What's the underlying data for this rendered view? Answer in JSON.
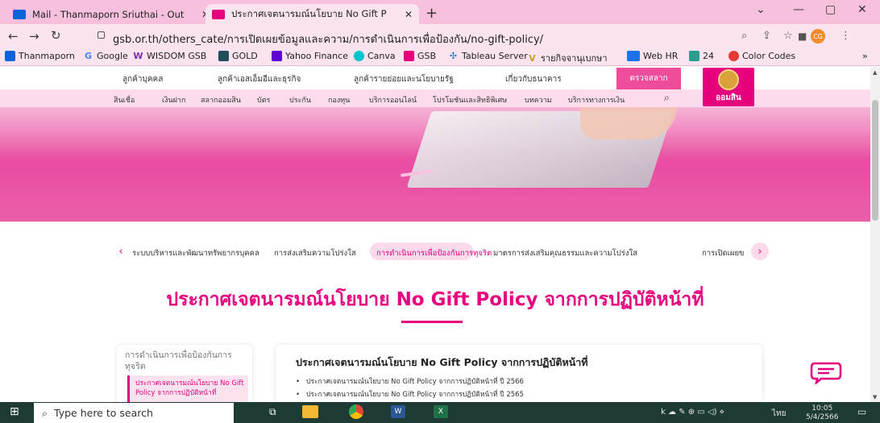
{
  "browser": {
    "tabs": [
      {
        "title": "Mail - Thanmaporn Sriuthai - Out",
        "active": false
      },
      {
        "title": "ประกาศเจตนารมณ์นโยบาย No Gift P",
        "active": true
      }
    ],
    "url": "gsb.or.th/others_cate/การเปิดเผยข้อมูลและความ/การดำเนินการเพื่อป้องกัน/no-gift-policy/",
    "profile_initials": "CG",
    "bookmarks": [
      {
        "label": "Thanmaporn",
        "icon": "outlook-icon",
        "color": "#0a64d8"
      },
      {
        "label": "Google",
        "icon": "google-icon",
        "color": "#4285f4"
      },
      {
        "label": "WISDOM GSB",
        "icon": "wisdom-icon",
        "color": "#7b2fb0"
      },
      {
        "label": "GOLD",
        "icon": "gold-icon",
        "color": "#1f4e5a"
      },
      {
        "label": "Yahoo Finance",
        "icon": "yahoo-icon",
        "color": "#6001d2"
      },
      {
        "label": "Canva",
        "icon": "canva-icon",
        "color": "#00c4cc"
      },
      {
        "label": "GSB",
        "icon": "gsb-icon",
        "color": "#e6007e"
      },
      {
        "label": "Tableau Server",
        "icon": "tableau-icon",
        "color": "#1f77b4"
      },
      {
        "label": "รายกิจจานุเบกษา",
        "icon": "gazette-icon",
        "color": "#c9a227"
      },
      {
        "label": "Web HR",
        "icon": "sap-icon",
        "color": "#1a73e8"
      },
      {
        "label": "24",
        "icon": "app24-icon",
        "color": "#2a9d8f"
      },
      {
        "label": "Color Codes",
        "icon": "colorcodes-icon",
        "color": "#e53935"
      }
    ]
  },
  "site": {
    "top_nav": [
      "ลูกค้าบุคคล",
      "ลูกค้าเอสเอ็มอีและธุรกิจ",
      "ลูกค้ารายย่อยและนโยบายรัฐ",
      "เกี่ยวกับธนาคาร"
    ],
    "lottery_label": "ตรวจสลาก",
    "sub_nav": [
      "สินเชื่อ",
      "เงินฝาก",
      "สลากออมสิน",
      "บัตร",
      "ประกัน",
      "กองทุน",
      "บริการออนไลน์",
      "โปรโมชันและสิทธิพิเศษ",
      "บทความ",
      "บริการทางการเงิน"
    ],
    "logo_text": "ออมสิน",
    "categories": [
      "ระบบบริหารและพัฒนาทรัพยากรบุคคล",
      "การส่งเสริมความโปร่งใส",
      "การดำเนินการเพื่อป้องกันการทุจริต",
      "มาตรการส่งเสริมคุณธรรมและความโปร่งใส",
      "การเปิดเผยข"
    ],
    "active_category_index": 2,
    "page_title": "ประกาศเจตนารมณ์นโยบาย No Gift Policy จากการปฏิบัติหน้าที่",
    "sidebar_heading": "การดำเนินการเพื่อป้องกันการทุจริต",
    "sidebar_item": "ประกาศเจตนารมณ์นโยบาย No Gift Policy จากการปฏิบัติหน้าที่",
    "content_heading": "ประกาศเจตนารมณ์นโยบาย No Gift Policy จากการปฏิบัติหน้าที่",
    "content_items": [
      "ประกาศเจตนารมณ์นโยบาย No Gift Policy จากการปฏิบัติหน้าที่ ปี 2566",
      "ประกาศเจตนารมณ์นโยบาย No Gift Policy จากการปฏิบัติหน้าที่ ปี 2565"
    ]
  },
  "taskbar": {
    "search_placeholder": "Type here to search",
    "lang": "ไทย",
    "time": "10:05",
    "date": "5/4/2566"
  }
}
